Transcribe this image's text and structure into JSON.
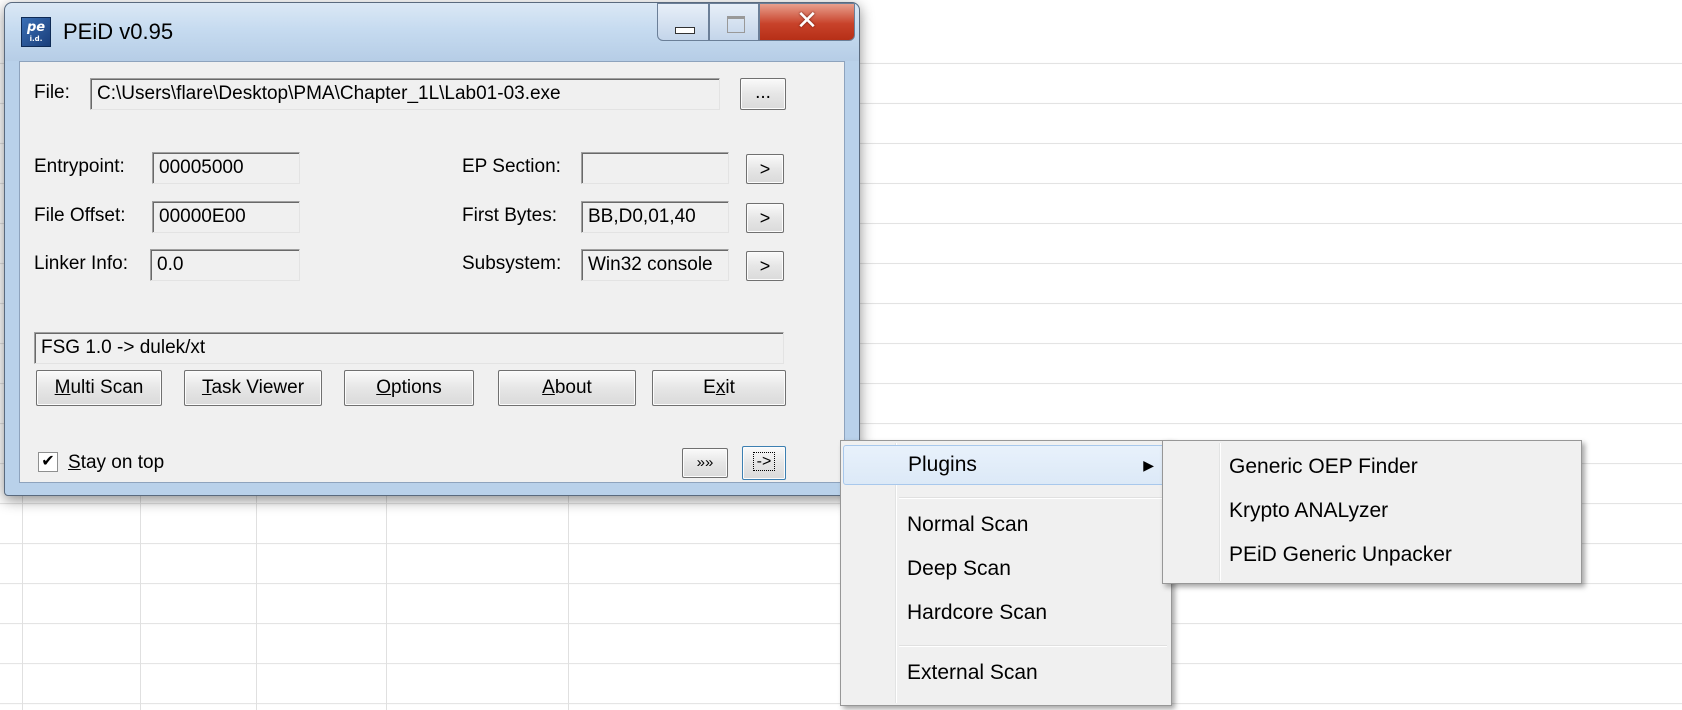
{
  "window": {
    "title": "PEiD v0.95",
    "icon": "peid-app-icon",
    "icon_text_top": "pe",
    "icon_text_bottom": "i.d."
  },
  "file": {
    "label": "File:",
    "value": "C:\\Users\\flare\\Desktop\\PMA\\Chapter_1L\\Lab01-03.exe",
    "browse_label": "..."
  },
  "fields": {
    "entrypoint": {
      "label": "Entrypoint:",
      "value": "00005000"
    },
    "file_offset": {
      "label": "File Offset:",
      "value": "00000E00"
    },
    "linker_info": {
      "label": "Linker Info:",
      "value": "0.0"
    },
    "ep_section": {
      "label": "EP Section:",
      "value": ""
    },
    "first_bytes": {
      "label": "First Bytes:",
      "value": "BB,D0,01,40"
    },
    "subsystem": {
      "label": "Subsystem:",
      "value": "Win32 console"
    },
    "arrow_label": ">"
  },
  "result": "FSG 1.0 -> dulek/xt",
  "buttons": {
    "multi_scan": {
      "u": "M",
      "rest": "ulti Scan"
    },
    "task_viewer": {
      "u": "T",
      "rest": "ask Viewer"
    },
    "options": {
      "u": "O",
      "rest": "ptions"
    },
    "about": {
      "u": "A",
      "rest": "bout"
    },
    "exit": {
      "pre": "E",
      "u": "x",
      "rest": "it"
    },
    "more": "»»",
    "menu_button": "->"
  },
  "stay_on_top": {
    "u": "S",
    "rest": "tay on top",
    "checked": true,
    "mark": "✔"
  },
  "menu": {
    "items": [
      "Plugins",
      "Normal Scan",
      "Deep Scan",
      "Hardcore Scan",
      "External Scan"
    ],
    "submenu_arrow": "▶"
  },
  "plugins_submenu": {
    "items": [
      "Generic OEP Finder",
      "Krypto ANALyzer",
      "PEiD Generic Unpacker"
    ]
  }
}
